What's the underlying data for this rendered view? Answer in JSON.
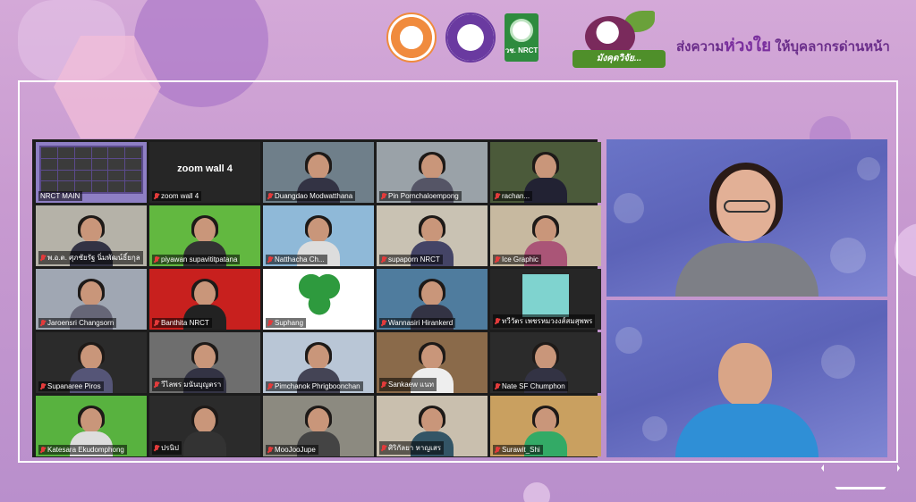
{
  "header": {
    "logo1_label": "",
    "logo2_label": "",
    "logo3_label": "วช. NRCT",
    "campaign_badge": "มังคุดวิจัย...",
    "slogan_prefix": "ส่งความ",
    "slogan_highlight": "ห่วงใย",
    "slogan_suffix": " ให้บุคลากรด่านหน้า"
  },
  "zoom_grid": {
    "tiles": [
      {
        "name": "NRCT MAIN",
        "muted": false,
        "type": "thumbnail"
      },
      {
        "name": "zoom wall 4",
        "muted": true,
        "type": "label",
        "center_label": "zoom wall 4"
      },
      {
        "name": "Duangdao Modwatthana",
        "muted": true,
        "type": "person"
      },
      {
        "name": "Pin Pornchaloempong",
        "muted": true,
        "type": "person"
      },
      {
        "name": "rachan...",
        "muted": true,
        "type": "person"
      },
      {
        "name": "พ.อ.ต. ศุภชัยรัฐ นิ่มพัฒน์ธิ์ยกุล",
        "muted": true,
        "type": "person"
      },
      {
        "name": "piyawan supavititpatana",
        "muted": true,
        "type": "person"
      },
      {
        "name": "Natthacha Ch...",
        "muted": true,
        "type": "person"
      },
      {
        "name": "supaporn NRCT",
        "muted": true,
        "type": "person"
      },
      {
        "name": "Ice Graphic",
        "muted": true,
        "type": "person"
      },
      {
        "name": "Jaroensri Changsorn",
        "muted": true,
        "type": "person"
      },
      {
        "name": "Banthita NRCT",
        "muted": true,
        "type": "person"
      },
      {
        "name": "Suphang",
        "muted": true,
        "type": "clover"
      },
      {
        "name": "Wannasiri Hirankerd",
        "muted": true,
        "type": "person"
      },
      {
        "name": "ทวีวัตร เพชรหมวงงส์สมสุพพร",
        "muted": true,
        "type": "blank"
      },
      {
        "name": "Supanaree Piros",
        "muted": true,
        "type": "person"
      },
      {
        "name": "วีไลพร มนันบุญตรา",
        "muted": true,
        "type": "person"
      },
      {
        "name": "Pimchanok Phrigboonchan",
        "muted": true,
        "type": "person"
      },
      {
        "name": "Sankaew แนท",
        "muted": true,
        "type": "person"
      },
      {
        "name": "Nate SF Chumphon",
        "muted": true,
        "type": "person"
      },
      {
        "name": "Katesara Ekudomphong",
        "muted": true,
        "type": "person"
      },
      {
        "name": "ปรนิป",
        "muted": true,
        "type": "person"
      },
      {
        "name": "MooJooJupe",
        "muted": true,
        "type": "person"
      },
      {
        "name": "ศิริกัลยา หาญเสร",
        "muted": true,
        "type": "person"
      },
      {
        "name": "Surawit_Shi",
        "muted": true,
        "type": "person"
      }
    ]
  },
  "speakers": [
    {
      "name": "",
      "role": "top"
    },
    {
      "name": "",
      "role": "bottom"
    }
  ],
  "colors": {
    "background": "#c89ad0",
    "accent_purple": "#6a2d8a",
    "grid_bg": "#1c1c1c",
    "active_border": "#e6d43a",
    "muted_icon": "#e23b3b"
  }
}
